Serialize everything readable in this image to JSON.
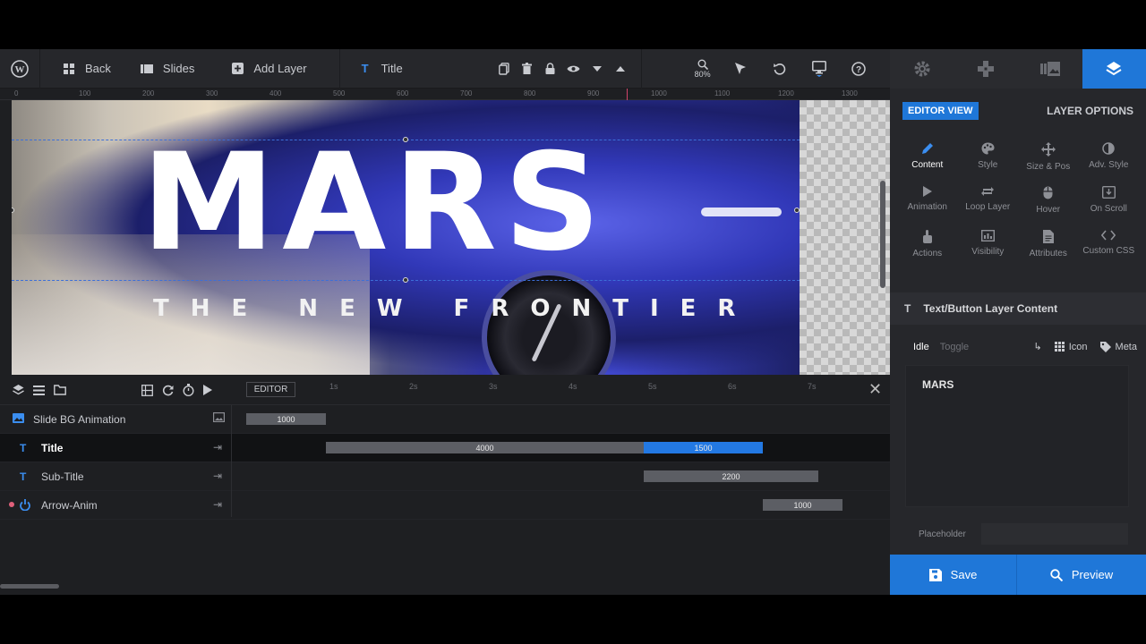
{
  "toolbar": {
    "back_label": "Back",
    "slides_label": "Slides",
    "add_layer_label": "Add Layer",
    "title_label": "Title",
    "zoom_level": "80%"
  },
  "ruler": [
    "0",
    "100",
    "200",
    "300",
    "400",
    "500",
    "600",
    "700",
    "800",
    "900",
    "1000",
    "1100",
    "1200",
    "1300"
  ],
  "canvas": {
    "headline": "MARS",
    "subline": "THE NEW FRONTIER"
  },
  "timeline": {
    "editor_tag": "EDITOR",
    "ticks": [
      "1s",
      "2s",
      "3s",
      "4s",
      "5s",
      "6s",
      "7s"
    ],
    "close_icon": "close-icon",
    "rows": [
      {
        "label": "Slide BG Animation",
        "icon": "image-icon",
        "bars": [
          {
            "value": "1000",
            "color": "grey"
          }
        ]
      },
      {
        "label": "Title",
        "icon": "text-icon",
        "bars": [
          {
            "value": "4000",
            "color": "grey"
          },
          {
            "value": "1500",
            "color": "blue"
          }
        ]
      },
      {
        "label": "Sub-Title",
        "icon": "text-icon",
        "bars": [
          {
            "value": "2200",
            "color": "grey"
          }
        ]
      },
      {
        "label": "Arrow-Anim",
        "icon": "power-icon",
        "bars": [
          {
            "value": "1000",
            "color": "grey"
          }
        ]
      }
    ]
  },
  "panel": {
    "editor_view": "EDITOR VIEW",
    "layer_options": "LAYER OPTIONS",
    "options": [
      {
        "label": "Content",
        "icon": "pencil-icon"
      },
      {
        "label": "Style",
        "icon": "palette-icon"
      },
      {
        "label": "Size & Pos",
        "icon": "move-icon"
      },
      {
        "label": "Adv. Style",
        "icon": "contrast-icon"
      },
      {
        "label": "Animation",
        "icon": "play-icon"
      },
      {
        "label": "Loop Layer",
        "icon": "loop-icon"
      },
      {
        "label": "Hover",
        "icon": "mouse-icon"
      },
      {
        "label": "On Scroll",
        "icon": "scroll-icon"
      },
      {
        "label": "Actions",
        "icon": "hand-icon"
      },
      {
        "label": "Visibility",
        "icon": "visibility-icon"
      },
      {
        "label": "Attributes",
        "icon": "document-icon"
      },
      {
        "label": "Custom CSS",
        "icon": "code-icon"
      }
    ],
    "section_title": "Text/Button Layer Content",
    "state_idle": "Idle",
    "state_toggle": "Toggle",
    "icon_label": "Icon",
    "meta_label": "Meta",
    "content_text": "MARS",
    "placeholder_label": "Placeholder",
    "placeholder_value": ""
  },
  "footer": {
    "save_label": "Save",
    "preview_label": "Preview"
  },
  "colors": {
    "accent": "#1f77d8",
    "bar_grey": "#5c5e64",
    "bar_blue": "#2379e3",
    "panel_bg": "#26272b"
  }
}
